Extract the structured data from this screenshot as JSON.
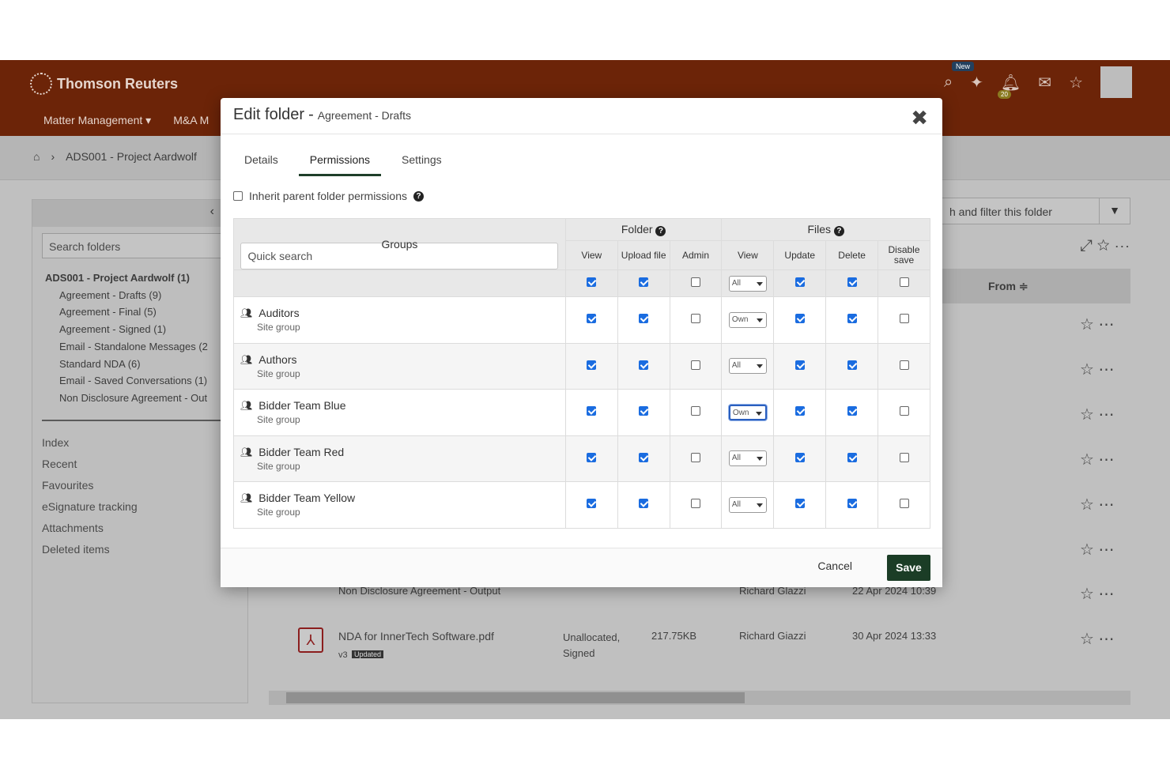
{
  "brand": {
    "name": "Thomson Reuters",
    "new_badge": "New",
    "notif_count": "20"
  },
  "nav": {
    "items": [
      "Matter Management ▾",
      "M&A M"
    ]
  },
  "breadcrumb": {
    "project": "ADS001 - Project Aardwolf"
  },
  "sidebar": {
    "search_placeholder": "Search folders",
    "root": "ADS001 - Project Aardwolf (1)",
    "folders": [
      "Agreement - Drafts (9)",
      "Agreement - Final (5)",
      "Agreement - Signed (1)",
      "Email - Standalone Messages (2",
      "Standard NDA (6)",
      "Email - Saved Conversations (1)",
      "Non Disclosure Agreement - Out"
    ],
    "links": [
      "Index",
      "Recent",
      "Favourites",
      "eSignature tracking",
      "Attachments",
      "Deleted items"
    ]
  },
  "main": {
    "search_filter": "h and filter this folder",
    "from_header": "From ≑",
    "bottom_row1": {
      "name": "Non Disclosure Agreement - Output",
      "owner": "Richard Glazzi",
      "date": "22 Apr 2024 10:39"
    },
    "bottom_row2": {
      "name": "NDA for InnerTech Software.pdf",
      "version": "v3",
      "badge": "Updated",
      "status": "Unallocated, Signed",
      "size": "217.75KB",
      "owner": "Richard Giazzi",
      "date": "30 Apr 2024 13:33"
    }
  },
  "modal": {
    "title": "Edit folder",
    "subtitle": "Agreement - Drafts",
    "tabs": [
      "Details",
      "Permissions",
      "Settings"
    ],
    "inherit_label": "Inherit parent folder permissions",
    "groups_header": "Groups",
    "quick_search_placeholder": "Quick search",
    "folder_header": "Folder",
    "files_header": "Files",
    "columns": {
      "view": "View",
      "upload": "Upload file",
      "admin": "Admin",
      "fview": "View",
      "update": "Update",
      "delete": "Delete",
      "disable": "Disable save"
    },
    "header_row": {
      "view": true,
      "upload": true,
      "admin": false,
      "fview": "All",
      "update": true,
      "delete": true,
      "disable": false
    },
    "groups": [
      {
        "name": "Auditors",
        "type": "Site group",
        "view": true,
        "upload": true,
        "admin": false,
        "fview": "Own",
        "update": true,
        "delete": true,
        "disable": false
      },
      {
        "name": "Authors",
        "type": "Site group",
        "view": true,
        "upload": true,
        "admin": false,
        "fview": "All",
        "update": true,
        "delete": true,
        "disable": false
      },
      {
        "name": "Bidder Team Blue",
        "type": "Site group",
        "view": true,
        "upload": true,
        "admin": false,
        "fview": "Own",
        "update": true,
        "delete": true,
        "disable": false
      },
      {
        "name": "Bidder Team Red",
        "type": "Site group",
        "view": true,
        "upload": true,
        "admin": false,
        "fview": "All",
        "update": true,
        "delete": true,
        "disable": false
      },
      {
        "name": "Bidder Team Yellow",
        "type": "Site group",
        "view": true,
        "upload": true,
        "admin": false,
        "fview": "All",
        "update": true,
        "delete": true,
        "disable": false
      }
    ],
    "cancel_label": "Cancel",
    "save_label": "Save"
  },
  "colors": {
    "topbar": "#6c2408",
    "save": "#1b3d26",
    "checkbox": "#1a6ce0"
  }
}
